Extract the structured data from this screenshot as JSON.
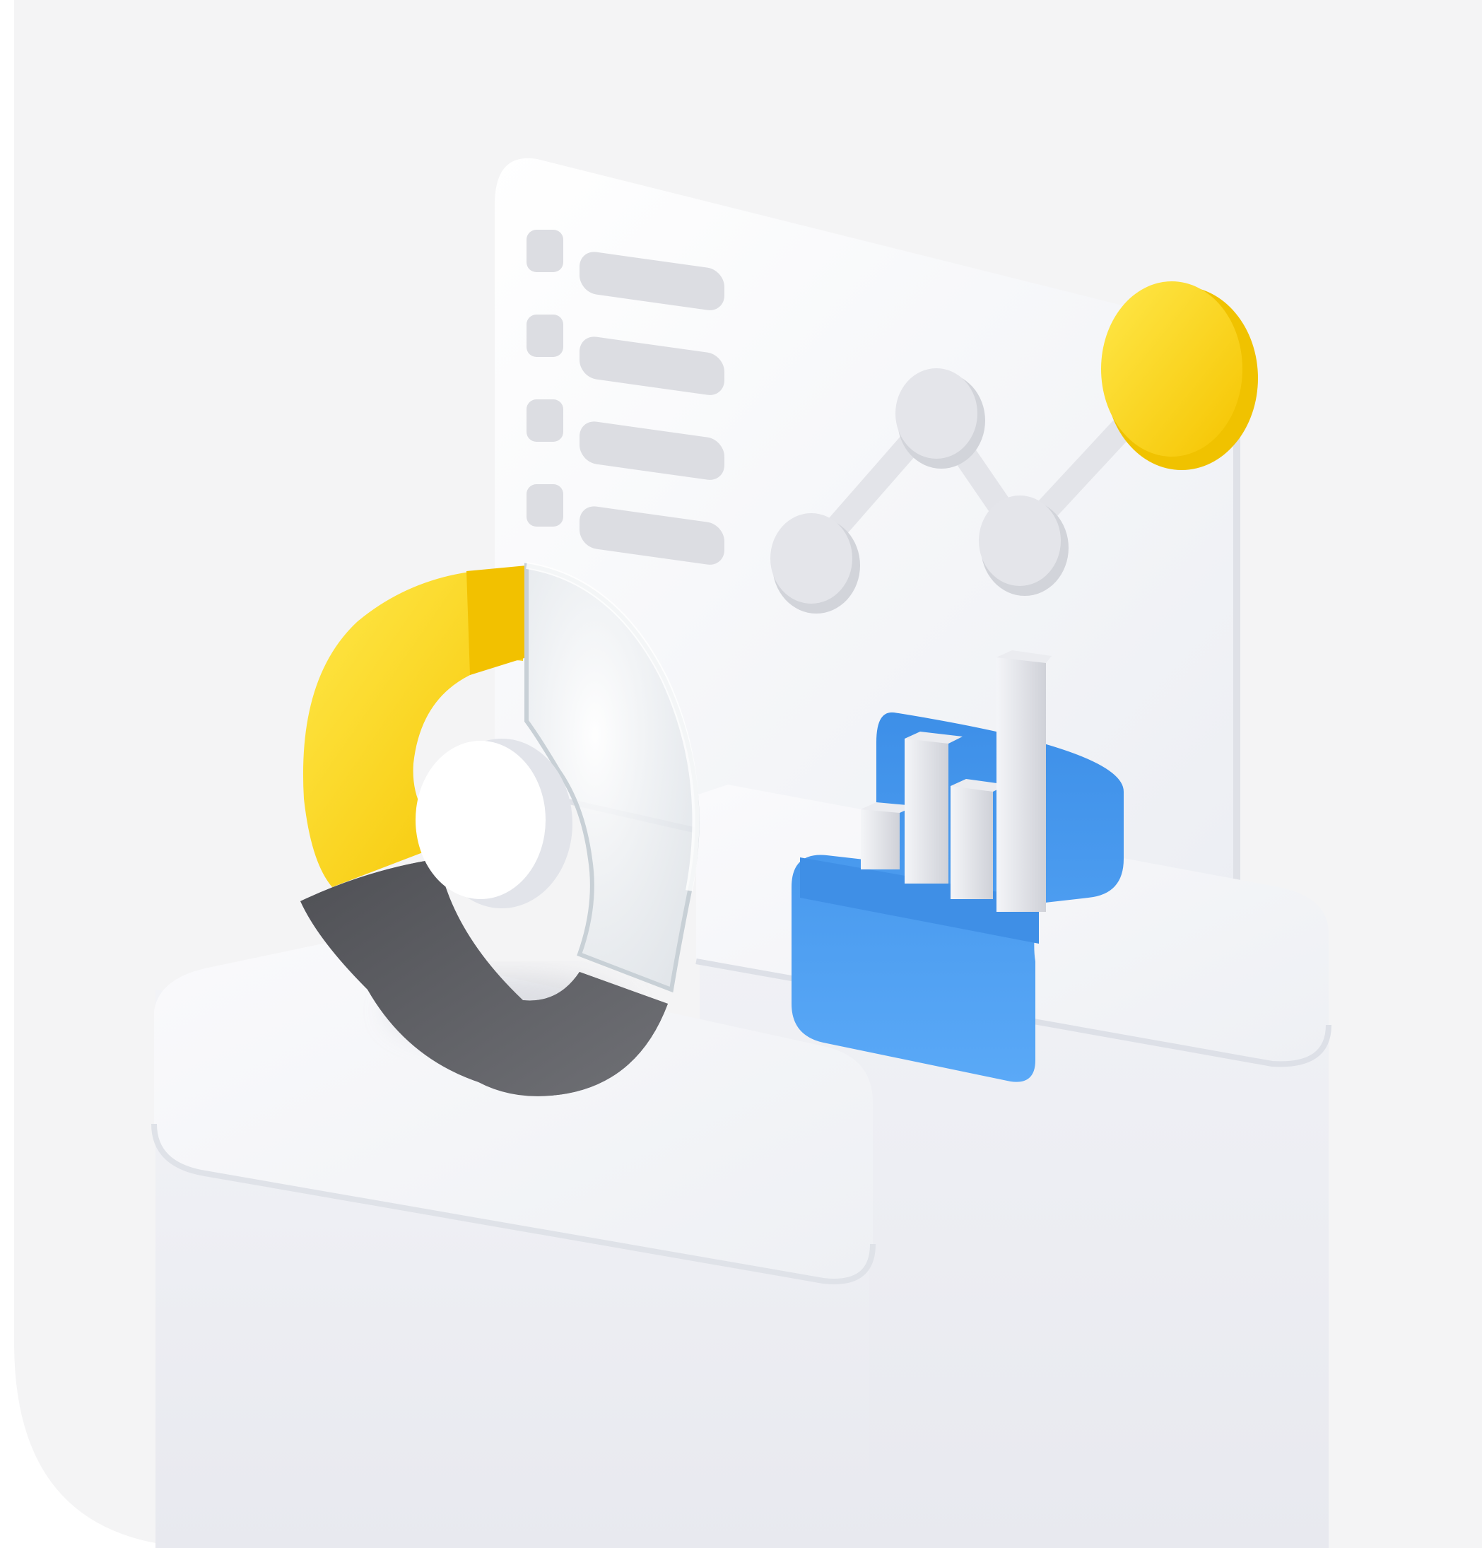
{
  "illustration": {
    "subject": "3d-analytics-dashboard",
    "colors": {
      "background_panel": "#f4f4f5",
      "pedestal": "#f3f4f8",
      "board": "#f7f8fb",
      "accent_yellow": "#ffd91a",
      "accent_blue": "#3f97f0",
      "dark_gray": "#5f6065",
      "widget_gray": "#dcdde2"
    },
    "icons": [
      "donut-chart-icon",
      "line-chart-icon",
      "bar-chart-icon",
      "list-icon"
    ],
    "donut_segments": [
      {
        "name": "yellow-segment",
        "color": "#ffd91a"
      },
      {
        "name": "glass-segment",
        "color": "#e9eef2"
      },
      {
        "name": "gray-segment",
        "color": "#5f6065"
      }
    ]
  }
}
